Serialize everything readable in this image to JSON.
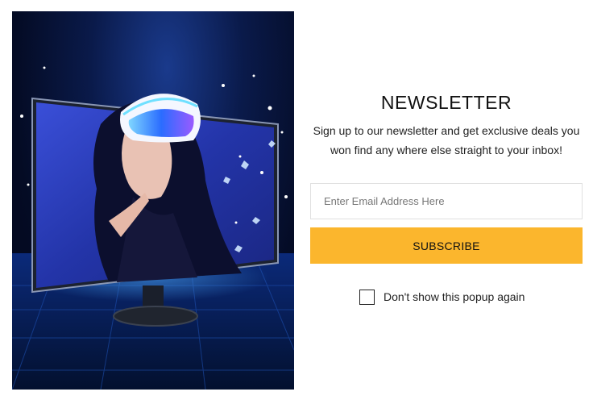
{
  "promo": {
    "image_description_icon": "vr-monitor-promo-image"
  },
  "newsletter": {
    "title": "NEWSLETTER",
    "description": "Sign up to our newsletter and get exclusive deals you won find any where else straight to your inbox!",
    "email_placeholder": "Enter Email Address Here",
    "email_value": "",
    "subscribe_label": "SUBSCRIBE",
    "dont_show_label": "Don't show this popup again",
    "dont_show_checked": false
  },
  "colors": {
    "accent": "#fbb62d",
    "title": "#111111",
    "promo_bg": "#040b24"
  }
}
